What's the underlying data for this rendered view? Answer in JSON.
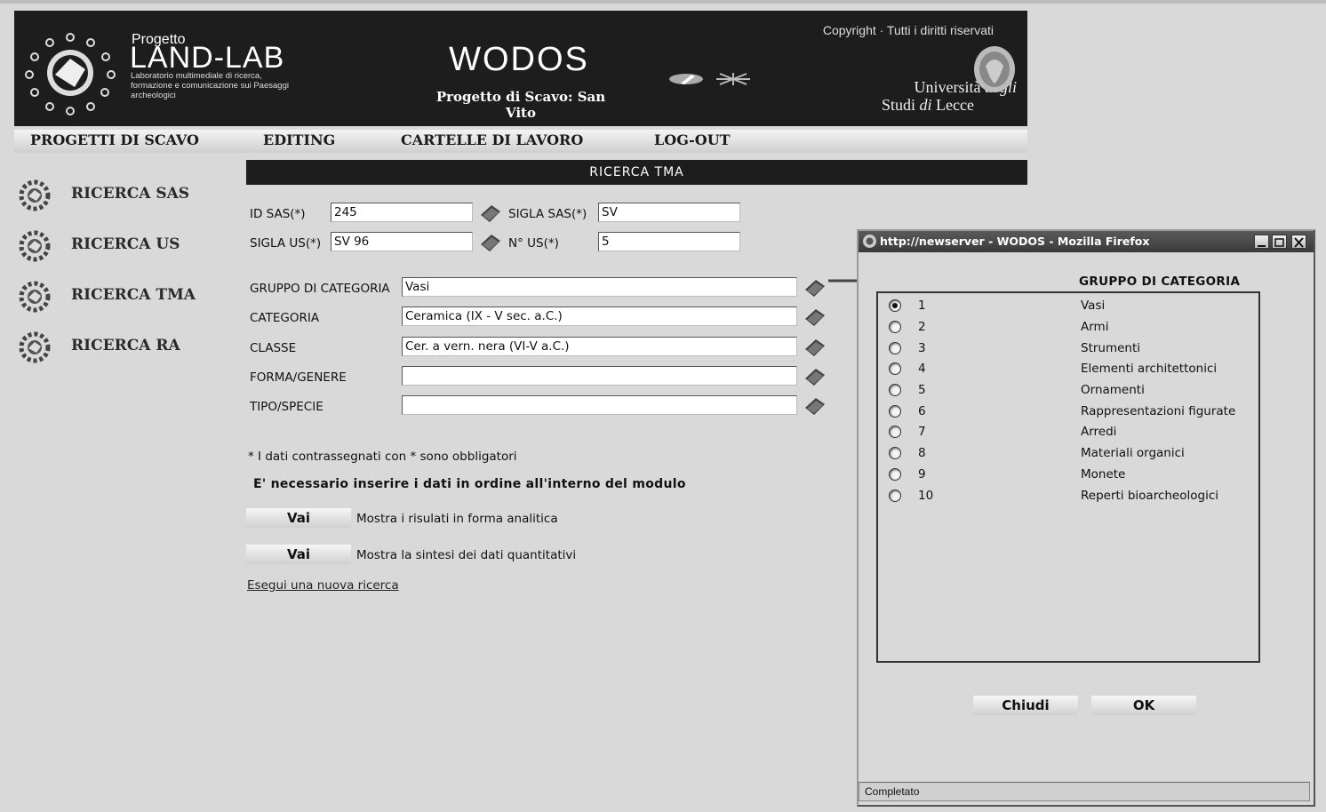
{
  "header": {
    "project_word": "Progetto",
    "project_name": "LAND-LAB",
    "project_desc": "Laboratorio multimediale di ricerca, formazione e comunicazione sui Paesaggi archeologici",
    "app_title": "WODOS",
    "app_subtitle": "Progetto di Scavo: San Vito",
    "copyright": "Copyright · Tutti i diritti riservati",
    "university_line1_a": "Università",
    "university_line1_b": "degli",
    "university_line2_a": "Studi",
    "university_line2_b": "di",
    "university_line2_c": "Lecce"
  },
  "menu": [
    "PROGETTI DI SCAVO",
    "EDITING",
    "CARTELLE DI LAVORO",
    "LOG-OUT"
  ],
  "sidebar": [
    "RICERCA SAS",
    "RICERCA US",
    "RICERCA TMA",
    "RICERCA RA"
  ],
  "form": {
    "banner": "RICERCA TMA",
    "id_sas_label": "ID SAS(*)",
    "id_sas_value": "245",
    "sigla_sas_label": "SIGLA SAS(*)",
    "sigla_sas_value": "SV",
    "sigla_us_label": "SIGLA US(*)",
    "sigla_us_value": "SV 96",
    "n_us_label": "N° US(*)",
    "n_us_value": "5",
    "fields": [
      {
        "label": "GRUPPO DI CATEGORIA",
        "value": "Vasi"
      },
      {
        "label": "CATEGORIA",
        "value": "Ceramica (IX - V sec. a.C.)"
      },
      {
        "label": "CLASSE",
        "value": "Cer. a vern. nera (VI-V a.C.)"
      },
      {
        "label": "FORMA/GENERE",
        "value": ""
      },
      {
        "label": "TIPO/SPECIE",
        "value": ""
      }
    ],
    "note_required": "* I dati contrassegnati con * sono obbligatori",
    "note_order": "E' necessario inserire i dati in ordine all'interno del modulo",
    "vai_label": "Vai",
    "vai1_desc": "Mostra i risulati in forma analitica",
    "vai2_desc": "Mostra la sintesi dei dati quantitativi",
    "new_search": "Esegui una nuova ricerca"
  },
  "popup": {
    "title": "http://newserver - WODOS - Mozilla Firefox",
    "list_title": "GRUPPO DI CATEGORIA",
    "selected": 1,
    "items": [
      {
        "num": "1",
        "name": "Vasi"
      },
      {
        "num": "2",
        "name": "Armi"
      },
      {
        "num": "3",
        "name": "Strumenti"
      },
      {
        "num": "4",
        "name": "Elementi architettonici"
      },
      {
        "num": "5",
        "name": "Ornamenti"
      },
      {
        "num": "6",
        "name": "Rappresentazioni figurate"
      },
      {
        "num": "7",
        "name": "Arredi"
      },
      {
        "num": "8",
        "name": "Materiali organici"
      },
      {
        "num": "9",
        "name": "Monete"
      },
      {
        "num": "10",
        "name": "Reperti bioarcheologici"
      }
    ],
    "close_label": "Chiudi",
    "ok_label": "OK",
    "status": "Completato"
  }
}
